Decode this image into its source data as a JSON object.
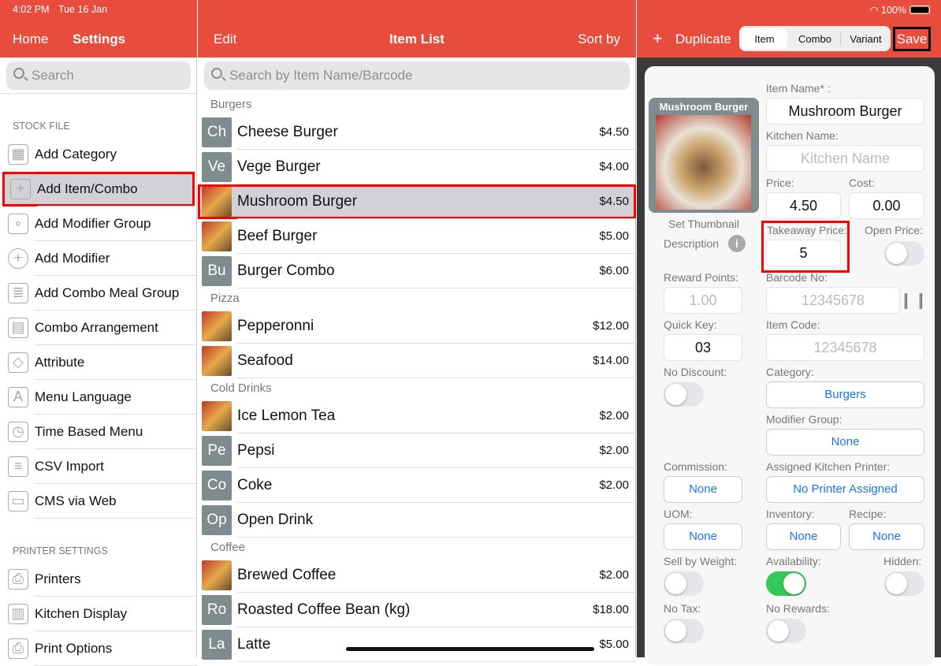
{
  "status": {
    "time": "4:02 PM",
    "date": "Tue 16 Jan",
    "battery": "100%"
  },
  "left": {
    "home": "Home",
    "title": "Settings",
    "search_placeholder": "Search",
    "sections": [
      {
        "title": "STOCK FILE"
      },
      {
        "title": "PRINTER SETTINGS"
      }
    ],
    "stock_items": [
      {
        "label": "Add Category",
        "icon": "category-grid-icon"
      },
      {
        "label": "Add Item/Combo",
        "icon": "plus-square-icon",
        "selected": true
      },
      {
        "label": "Add Modifier Group",
        "icon": "modifier-group-icon"
      },
      {
        "label": "Add Modifier",
        "icon": "plus-circle-icon"
      },
      {
        "label": "Add Combo Meal Group",
        "icon": "combo-meal-icon"
      },
      {
        "label": "Combo Arrangement",
        "icon": "arrangement-icon"
      },
      {
        "label": "Attribute",
        "icon": "tag-icon"
      },
      {
        "label": "Menu Language",
        "icon": "language-icon"
      },
      {
        "label": "Time Based Menu",
        "icon": "clock-icon"
      },
      {
        "label": "CSV Import",
        "icon": "csv-icon"
      },
      {
        "label": "CMS via Web",
        "icon": "web-icon"
      }
    ],
    "printer_items": [
      {
        "label": "Printers",
        "icon": "printer-icon"
      },
      {
        "label": "Kitchen Display",
        "icon": "kitchen-display-icon"
      },
      {
        "label": "Print Options",
        "icon": "print-options-icon"
      }
    ]
  },
  "mid": {
    "edit": "Edit",
    "title": "Item List",
    "sort": "Sort by",
    "search_placeholder": "Search by Item Name/Barcode",
    "groups": [
      {
        "name": "Burgers",
        "items": [
          {
            "abbr": "Ch",
            "name": "Cheese Burger",
            "price": "$4.50"
          },
          {
            "abbr": "Ve",
            "name": "Vege Burger",
            "price": "$4.00"
          },
          {
            "abbr": "",
            "img": true,
            "name": "Mushroom Burger",
            "price": "$4.50",
            "selected": true
          },
          {
            "abbr": "",
            "img": true,
            "name": "Beef Burger",
            "price": "$5.00"
          },
          {
            "abbr": "Bu",
            "name": "Burger Combo",
            "price": "$6.00"
          }
        ]
      },
      {
        "name": "Pizza",
        "items": [
          {
            "abbr": "",
            "img": true,
            "name": "Pepperonni",
            "price": "$12.00"
          },
          {
            "abbr": "",
            "img": true,
            "name": "Seafood",
            "price": "$14.00"
          }
        ]
      },
      {
        "name": "Cold Drinks",
        "items": [
          {
            "abbr": "",
            "img": true,
            "name": "Ice Lemon Tea",
            "price": "$2.00"
          },
          {
            "abbr": "Pe",
            "name": "Pepsi",
            "price": "$2.00"
          },
          {
            "abbr": "Co",
            "name": "Coke",
            "price": "$2.00"
          },
          {
            "abbr": "Op",
            "name": "Open Drink",
            "price": ""
          }
        ]
      },
      {
        "name": "Coffee",
        "items": [
          {
            "abbr": "",
            "img": true,
            "name": "Brewed Coffee",
            "price": "$2.00"
          },
          {
            "abbr": "Ro",
            "name": "Roasted Coffee Bean (kg)",
            "price": "$18.00"
          },
          {
            "abbr": "La",
            "name": "Latte",
            "price": "$5.00"
          }
        ]
      }
    ]
  },
  "right": {
    "duplicate": "Duplicate",
    "segments": [
      "Item",
      "Combo",
      "Variant"
    ],
    "active_segment": "Item",
    "save": "Save",
    "thumb_title": "Mushroom Burger",
    "set_thumbnail": "Set Thumbnail",
    "description": "Description",
    "item_name_label": "Item Name* :",
    "item_name": "Mushroom Burger",
    "kitchen_name_label": "Kitchen Name:",
    "kitchen_name_placeholder": "Kitchen Name",
    "price_label": "Price:",
    "price": "4.50",
    "cost_label": "Cost:",
    "cost": "0.00",
    "takeaway_label": "Takeaway Price:",
    "takeaway": "5",
    "open_price_label": "Open Price:",
    "open_price": false,
    "reward_label": "Reward Points:",
    "reward_placeholder": "1.00",
    "barcode_label": "Barcode No:",
    "barcode_placeholder": "12345678",
    "quick_key_label": "Quick Key:",
    "quick_key": "03",
    "item_code_label": "Item Code:",
    "item_code_placeholder": "12345678",
    "no_discount_label": "No Discount:",
    "no_discount": false,
    "category_label": "Category:",
    "category": "Burgers",
    "modifier_label": "Modifier Group:",
    "modifier": "None",
    "commission_label": "Commission:",
    "commission": "None",
    "printer_label": "Assigned Kitchen Printer:",
    "printer": "No Printer Assigned",
    "uom_label": "UOM:",
    "uom": "None",
    "inventory_label": "Inventory:",
    "inventory": "None",
    "recipe_label": "Recipe:",
    "recipe": "None",
    "sell_weight_label": "Sell by Weight:",
    "sell_weight": false,
    "availability_label": "Availability:",
    "availability": true,
    "hidden_label": "Hidden:",
    "hidden": false,
    "no_tax_label": "No Tax:",
    "no_tax": false,
    "no_rewards_label": "No Rewards:",
    "no_rewards": false
  },
  "colors": {
    "brand": "#e84c3d",
    "link": "#1a73e8",
    "toggle_on": "#34c759",
    "highlight": "#ff0000"
  }
}
